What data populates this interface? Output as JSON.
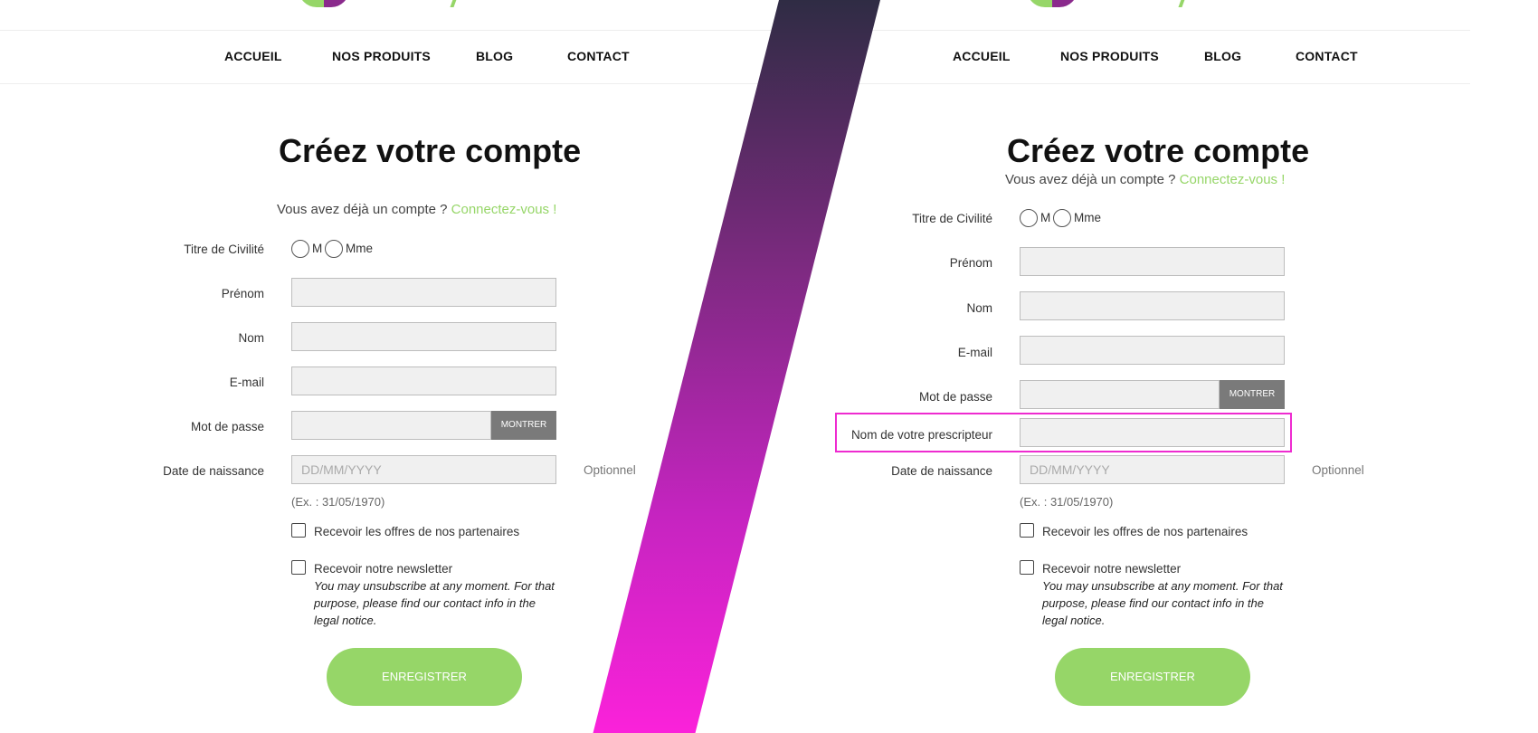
{
  "nav": {
    "home": "ACCUEIL",
    "products": "NOS PRODUITS",
    "blog": "BLOG",
    "contact": "CONTACT"
  },
  "form": {
    "title": "Créez votre compte",
    "login_prompt": "Vous avez déjà un compte ?",
    "login_link": "Connectez-vous !",
    "civility_label": "Titre de Civilité",
    "civility_m": "M",
    "civility_mme": "Mme",
    "firstname_label": "Prénom",
    "lastname_label": "Nom",
    "email_label": "E-mail",
    "password_label": "Mot de passe",
    "show_password": "MONTRER",
    "prescriber_label": "Nom de votre prescripteur",
    "birthdate_label": "Date de naissance",
    "birthdate_placeholder": "DD/MM/YYYY",
    "optional": "Optionnel",
    "birthdate_hint": "(Ex. : 31/05/1970)",
    "partners_offers": "Recevoir les offres de nos partenaires",
    "newsletter": "Recevoir notre newsletter",
    "newsletter_disclaimer": "You may unsubscribe at any moment. For that purpose, please find our contact info in the legal notice.",
    "submit": "ENREGISTRER"
  },
  "colors": {
    "accent_green": "#96d668",
    "logo_purple": "#8a2a8c",
    "highlight_pink": "#ee2bd0",
    "band_top": "#2f2c44",
    "band_bottom": "#fb22da"
  }
}
